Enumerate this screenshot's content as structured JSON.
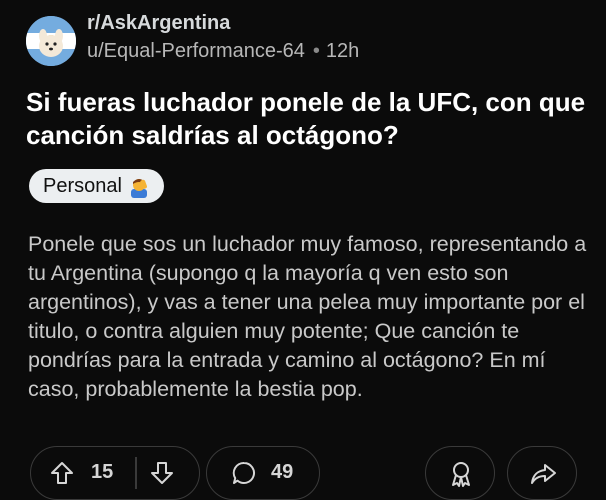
{
  "post": {
    "subreddit": "r/AskArgentina",
    "author": "u/Equal-Performance-64",
    "separator": "•",
    "age": "12h",
    "title": "Si fueras luchador ponele de la UFC, con que canción saldrías al octágono?",
    "flair": "Personal",
    "body": "Ponele que sos un luchador muy famoso, representando a tu Argentina (supongo q la mayoría q ven esto son argentinos), y vas a tener una pelea muy importante por el titulo, o contra alguien muy potente; Que canción te pondrías para la entrada y camino al octágono? En mí caso, probablemente la bestia pop."
  },
  "actions": {
    "upvotes": "15",
    "comments": "49"
  },
  "icons": {
    "avatar": "subreddit-avatar",
    "flair_emoji": "person-facepalm-emoji",
    "upvote": "arrow-up-icon",
    "downvote": "arrow-down-icon",
    "comment": "comment-bubble-icon",
    "award": "award-icon",
    "share": "share-icon"
  },
  "colors": {
    "background": "#0b0b0b",
    "flair_bg": "#eceff1",
    "avatar_bg": "#7fb2e5"
  }
}
